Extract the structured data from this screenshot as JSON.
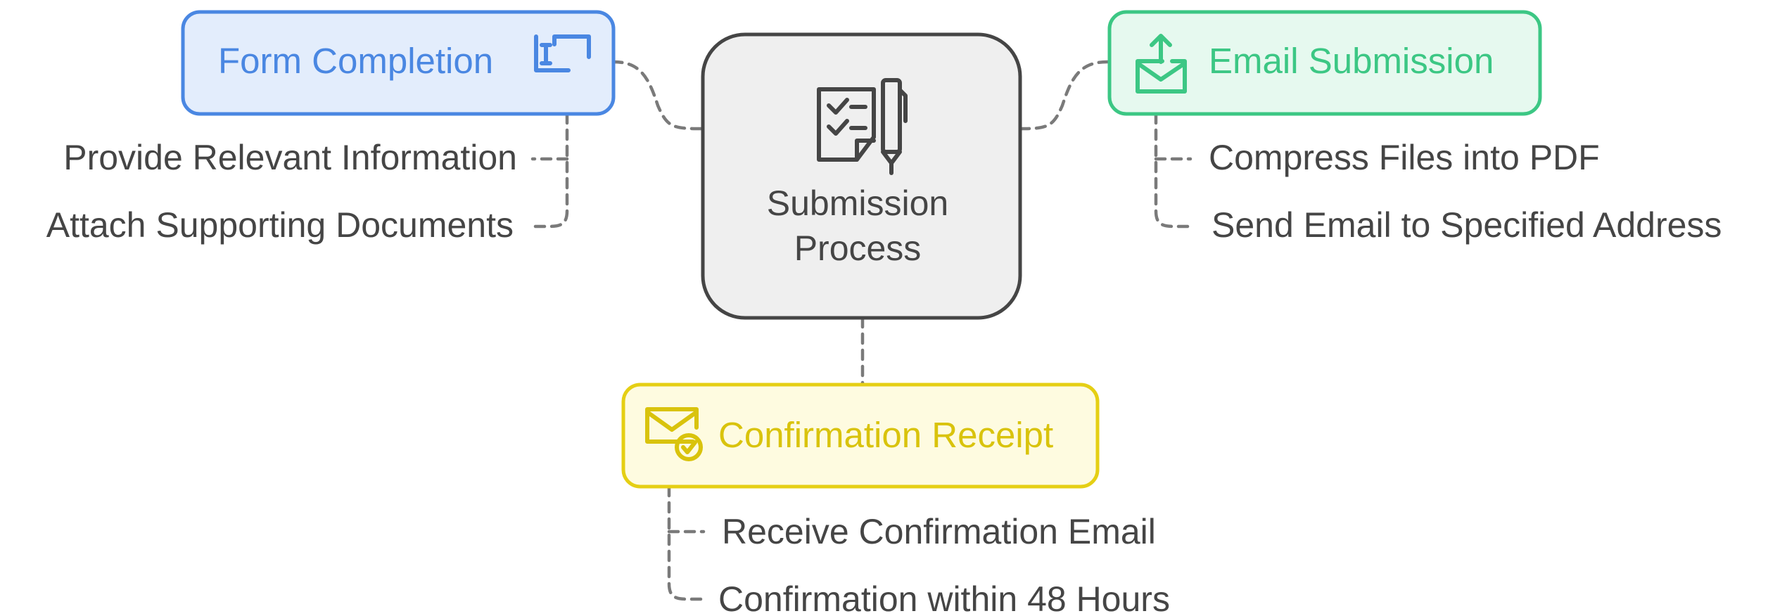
{
  "center": {
    "title_line1": "Submission",
    "title_line2": "Process",
    "icon": "checklist-pen-icon"
  },
  "form_completion": {
    "title": "Form Completion",
    "icon": "text-cursor-box-icon",
    "items": [
      "Provide Relevant Information",
      "Attach Supporting Documents"
    ]
  },
  "email_submission": {
    "title": "Email Submission",
    "icon": "envelope-upload-icon",
    "items": [
      "Compress Files into PDF",
      "Send Email to Specified Address"
    ]
  },
  "confirmation_receipt": {
    "title": "Confirmation Receipt",
    "icon": "envelope-check-icon",
    "items": [
      "Receive Confirmation Email",
      "Confirmation within 48 Hours"
    ]
  },
  "colors": {
    "center_fill": "#efefef",
    "center_stroke": "#454545",
    "text_dark": "#454545",
    "connector": "#7a7a7a",
    "form_fill": "#e3edfc",
    "form_stroke": "#4a87e2",
    "form_text": "#4a87e2",
    "email_fill": "#e6f9ef",
    "email_stroke": "#3cc784",
    "email_text": "#3cc784",
    "confirm_fill": "#fefbe0",
    "confirm_stroke": "#e5cf14",
    "confirm_text": "#d9c30c"
  }
}
